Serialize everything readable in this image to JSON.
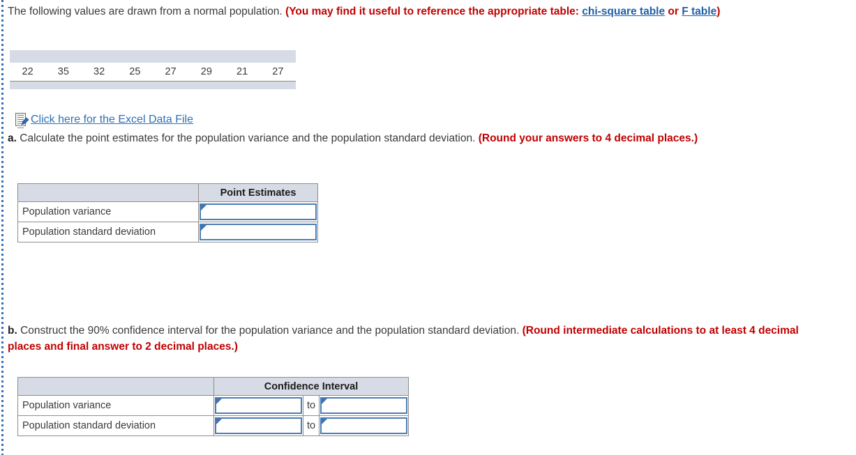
{
  "intro": {
    "sentence": "The following values are drawn from a normal population.",
    "note_prefix": "(You may find it useful to reference the appropriate table: ",
    "link_chi": "chi-square table",
    "note_or": "or ",
    "link_f": "F table",
    "note_suffix": ")"
  },
  "data_strip": {
    "values": [
      "22",
      "35",
      "32",
      "25",
      "27",
      "29",
      "21",
      "27"
    ]
  },
  "excel": {
    "icon": "excel-document-icon",
    "link_label": "Click here for the Excel Data File"
  },
  "question_a": {
    "label": "a.",
    "text": "Calculate the point estimates for the population variance and the population standard deviation.",
    "rounding_note": "(Round your answers to 4 decimal places.)"
  },
  "question_b": {
    "label": "b.",
    "text": "Construct the 90% confidence interval for the population variance and the population standard deviation.",
    "rounding_note": "(Round intermediate calculations to at least 4 decimal places and final answer to 2 decimal places.)"
  },
  "point_estimates_table": {
    "blank_header": "",
    "header": "Point Estimates",
    "rows": [
      {
        "label": "Population variance",
        "value": ""
      },
      {
        "label": "Population standard deviation",
        "value": ""
      }
    ]
  },
  "confidence_interval_table": {
    "blank_header": "",
    "header": "Confidence Interval",
    "separator": "to",
    "rows": [
      {
        "label": "Population variance",
        "lower": "",
        "upper": ""
      },
      {
        "label": "Population standard deviation",
        "lower": "",
        "upper": ""
      }
    ]
  },
  "colors": {
    "red_note": "#c00000",
    "link_blue": "#1f5fa8",
    "header_fill": "#d6dbe5",
    "input_border": "#4a7db5",
    "rail_blue": "#2f6fb5"
  }
}
